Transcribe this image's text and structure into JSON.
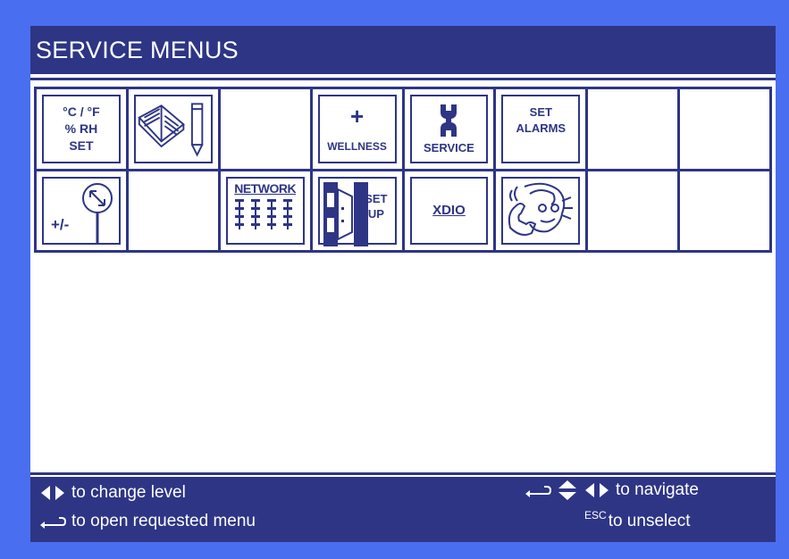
{
  "window": {
    "title": "SERVICE MENUS"
  },
  "tiles": {
    "units": {
      "line1": "°C / °F",
      "line2": "% RH",
      "line3": "SET"
    },
    "manual": {
      "icon": "open-book-pencil-icon"
    },
    "wellness": {
      "symbol": "+",
      "label": "WELLNESS"
    },
    "service": {
      "icon": "wrench-icon",
      "label": "SERVICE"
    },
    "alarms": {
      "line1": "SET",
      "line2": "ALARMS"
    },
    "offset": {
      "label": "+/-",
      "icon": "sensor-probe-icon"
    },
    "network": {
      "label": "NETWORK",
      "icon": "network-nodes-icon"
    },
    "setup": {
      "line1": "SET",
      "line2": "UP",
      "icon": "door-icon"
    },
    "xdio": {
      "label": "XDIO"
    },
    "support": {
      "icon": "technician-phone-icon"
    }
  },
  "footer": {
    "change_level": "to change level",
    "open_menu": "to open requested menu",
    "navigate": "to navigate",
    "esc": "ESC",
    "unselect": "to unselect"
  },
  "colors": {
    "primary": "#2e3585",
    "frame": "#4a6ef0",
    "background": "#ffffff"
  }
}
